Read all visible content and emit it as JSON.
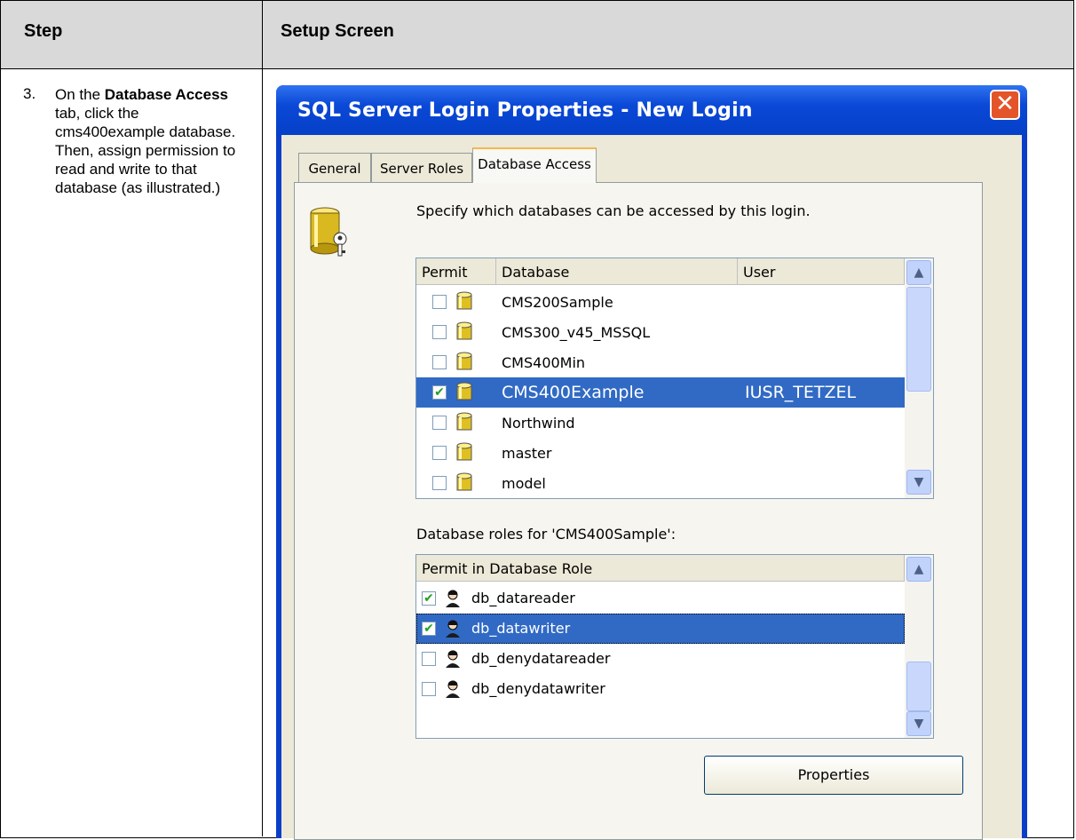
{
  "table": {
    "header_step": "Step",
    "header_setup": "Setup Screen"
  },
  "step": {
    "number": "3.",
    "text_before_bold": "On the ",
    "text_bold": "Database Access",
    "text_after_bold": " tab, click the cms400example database. Then, assign permission to read and write to that database (as illustrated.)"
  },
  "dialog": {
    "title": "SQL Server Login Properties - New Login",
    "close_glyph": "✕",
    "tabs": [
      "General",
      "Server Roles",
      "Database Access"
    ],
    "active_tab": "Database Access",
    "description": "Specify which databases can be accessed by this login.",
    "db_list": {
      "columns": [
        "Permit",
        "Database",
        "User"
      ],
      "rows": [
        {
          "checked": false,
          "database": "CMS200Sample",
          "user": ""
        },
        {
          "checked": false,
          "database": "CMS300_v45_MSSQL",
          "user": ""
        },
        {
          "checked": false,
          "database": "CMS400Min",
          "user": ""
        },
        {
          "checked": true,
          "database": "CMS400Example",
          "user": "IUSR_TETZEL",
          "selected": true
        },
        {
          "checked": false,
          "database": "Northwind",
          "user": ""
        },
        {
          "checked": false,
          "database": "master",
          "user": ""
        },
        {
          "checked": false,
          "database": "model",
          "user": ""
        }
      ]
    },
    "roles_label": "Database roles for 'CMS400Sample':",
    "roles_list": {
      "column": "Permit in Database Role",
      "rows": [
        {
          "checked": true,
          "role": "db_datareader"
        },
        {
          "checked": true,
          "role": "db_datawriter",
          "selected": true
        },
        {
          "checked": false,
          "role": "db_denydatareader"
        },
        {
          "checked": false,
          "role": "db_denydatawriter"
        }
      ]
    },
    "properties_button": "Properties",
    "check_glyph": "✔",
    "scroll_up_glyph": "▲",
    "scroll_down_glyph": "▼"
  },
  "colors": {
    "titlebar": "#0a48d6",
    "selection": "#316ac5",
    "dialog_face": "#ece9d8",
    "check": "#21a121"
  }
}
